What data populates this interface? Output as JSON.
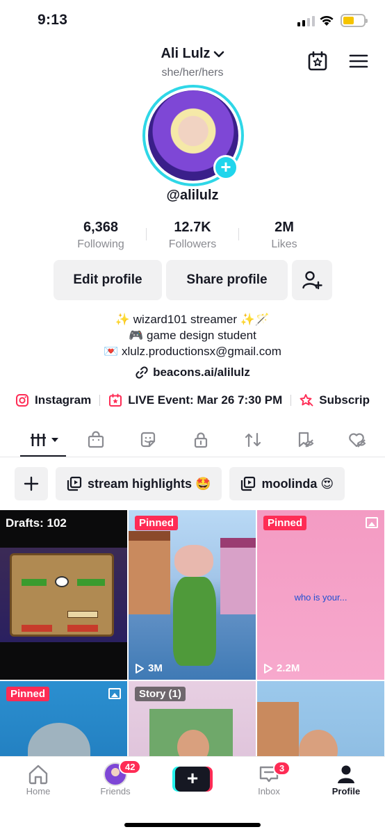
{
  "status_bar": {
    "time": "9:13",
    "signal_bars": 2,
    "battery_level": 0.55
  },
  "header": {
    "username": "Ali Lulz",
    "pronouns": "she/her/hers",
    "handle": "@alilulz",
    "icons": [
      "chevron-down-icon",
      "calendar-star-icon",
      "hamburger-menu-icon"
    ]
  },
  "stats": [
    {
      "value": "6,368",
      "label": "Following"
    },
    {
      "value": "12.7K",
      "label": "Followers"
    },
    {
      "value": "2M",
      "label": "Likes"
    }
  ],
  "actions": {
    "edit_label": "Edit profile",
    "share_label": "Share profile",
    "add_friend_icon": "add-friend-icon"
  },
  "bio": {
    "line1": "✨ wizard101 streamer ✨🪄",
    "line2": "🎮 game design student",
    "line3": "💌 xlulz.productionsx@gmail.com",
    "link": "beacons.ai/alilulz"
  },
  "chips": [
    {
      "label": "Instagram",
      "icon": "instagram-icon"
    },
    {
      "label": "LIVE Event: Mar 26 7:30 PM",
      "icon": "calendar-star-icon"
    },
    {
      "label": "Subscrip",
      "icon": "subscription-star-icon"
    }
  ],
  "tabs": [
    "videos-grid-icon",
    "shop-bag-icon",
    "sticker-icon",
    "lock-icon",
    "repost-icon",
    "bookmark-hidden-icon",
    "heart-hidden-icon"
  ],
  "playlists": [
    {
      "label": "stream highlights 🤩"
    },
    {
      "label": "moolinda 😍"
    }
  ],
  "grid": {
    "drafts_label": "Drafts: 102",
    "items": [
      {
        "badge": "Pinned",
        "views": "3M"
      },
      {
        "badge": "Pinned",
        "views": "2.2M",
        "caption": "who is your..."
      },
      {
        "badge": "Pinned"
      },
      {
        "badge": "Story (1)"
      }
    ]
  },
  "bottom_nav": {
    "home": "Home",
    "friends": "Friends",
    "friends_badge": "42",
    "inbox": "Inbox",
    "inbox_badge": "3",
    "profile": "Profile"
  },
  "colors": {
    "accent_pink": "#fe2c55",
    "accent_cyan": "#25f4ee",
    "text": "#161823",
    "muted": "#8a8b91",
    "button_bg": "#f1f1f2"
  }
}
